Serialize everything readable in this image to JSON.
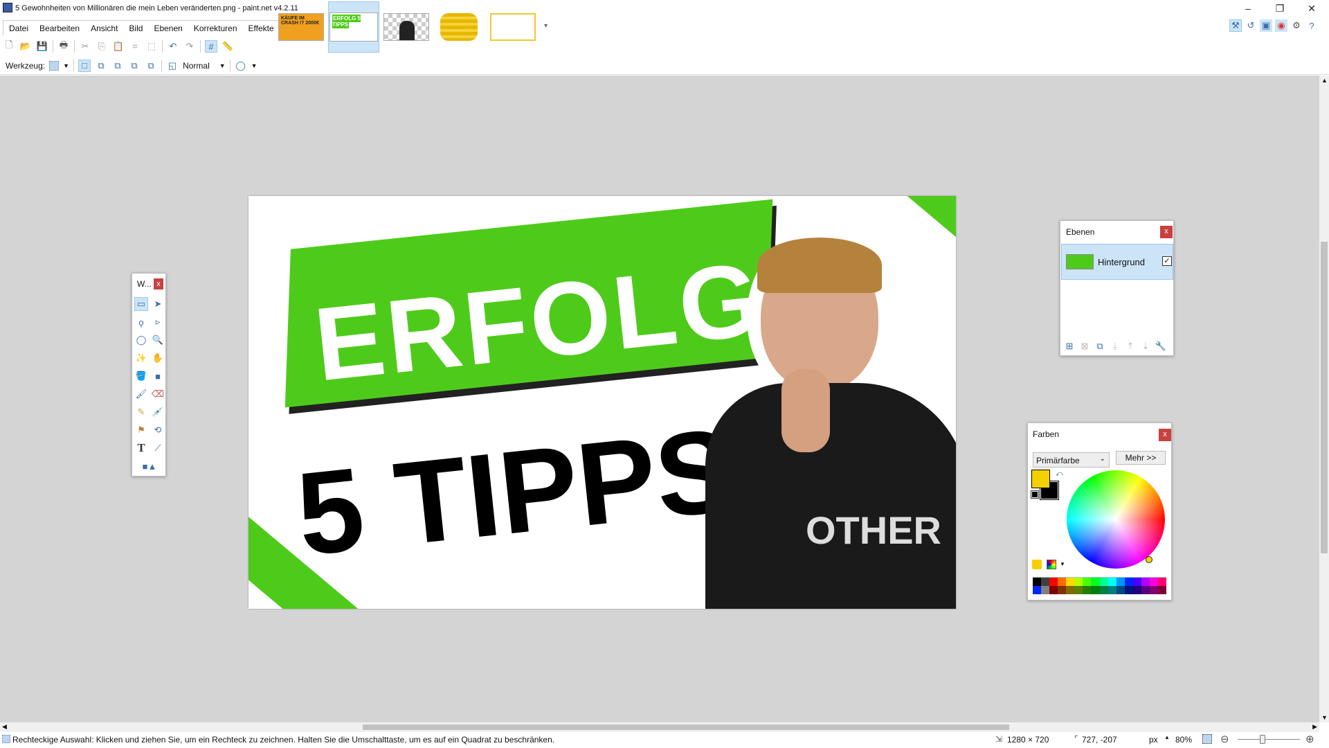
{
  "window": {
    "title": "5 Gewohnheiten von Millionären die mein Leben veränderten.png - paint.net v4.2.11",
    "minimize": "–",
    "restore": "❐",
    "close": "✕"
  },
  "menu": [
    "Datei",
    "Bearbeiten",
    "Ansicht",
    "Bild",
    "Ebenen",
    "Korrekturen",
    "Effekte"
  ],
  "image_tabs": [
    {
      "label": "KÄUFE IM CRASH !? 2000€",
      "selected": false
    },
    {
      "label": "ERFOLG 5 TIPPS",
      "selected": true
    },
    {
      "label": "transparent person",
      "selected": false
    },
    {
      "label": "coins",
      "selected": false
    },
    {
      "label": "",
      "selected": false
    }
  ],
  "options": {
    "tool_label": "Werkzeug:",
    "blend_mode": "Normal"
  },
  "canvas": {
    "headline": "ERFOLG",
    "subline": "5 TIPPS",
    "shirt_text": "OTHER",
    "green": "#4ecb1a"
  },
  "tools_window": {
    "title": "W...",
    "close": "x"
  },
  "layers_panel": {
    "title": "Ebenen",
    "close": "x",
    "layers": [
      {
        "name": "Hintergrund",
        "visible": true
      }
    ]
  },
  "colors_panel": {
    "title": "Farben",
    "close": "x",
    "mode": "Primärfarbe",
    "more": "Mehr >>",
    "primary": "#f5d000",
    "secondary": "#000000",
    "palette_top": [
      "#000000",
      "#404040",
      "#ff0000",
      "#ff6a00",
      "#ffd800",
      "#b6ff00",
      "#4cff00",
      "#00ff21",
      "#00ff90",
      "#00ffff",
      "#0094ff",
      "#0026ff",
      "#4800ff",
      "#b200ff",
      "#ff00dc",
      "#ff006e"
    ],
    "palette_bottom": [
      "#0026ff",
      "#808080",
      "#7f0000",
      "#7f3300",
      "#7f6a00",
      "#5b7f00",
      "#267f00",
      "#007f0e",
      "#007f46",
      "#007f7f",
      "#004a7f",
      "#00137f",
      "#21007f",
      "#57007f",
      "#7f006e",
      "#7f0037"
    ]
  },
  "status": {
    "hint": "Rechteckige Auswahl: Klicken und ziehen Sie, um ein Rechteck zu zeichnen. Halten Sie die Umschalttaste, um es auf ein Quadrat zu beschränken.",
    "image_size": "1280 × 720",
    "cursor": "727, -207",
    "unit": "px",
    "zoom": "80%",
    "zoom_level": 0.4
  }
}
